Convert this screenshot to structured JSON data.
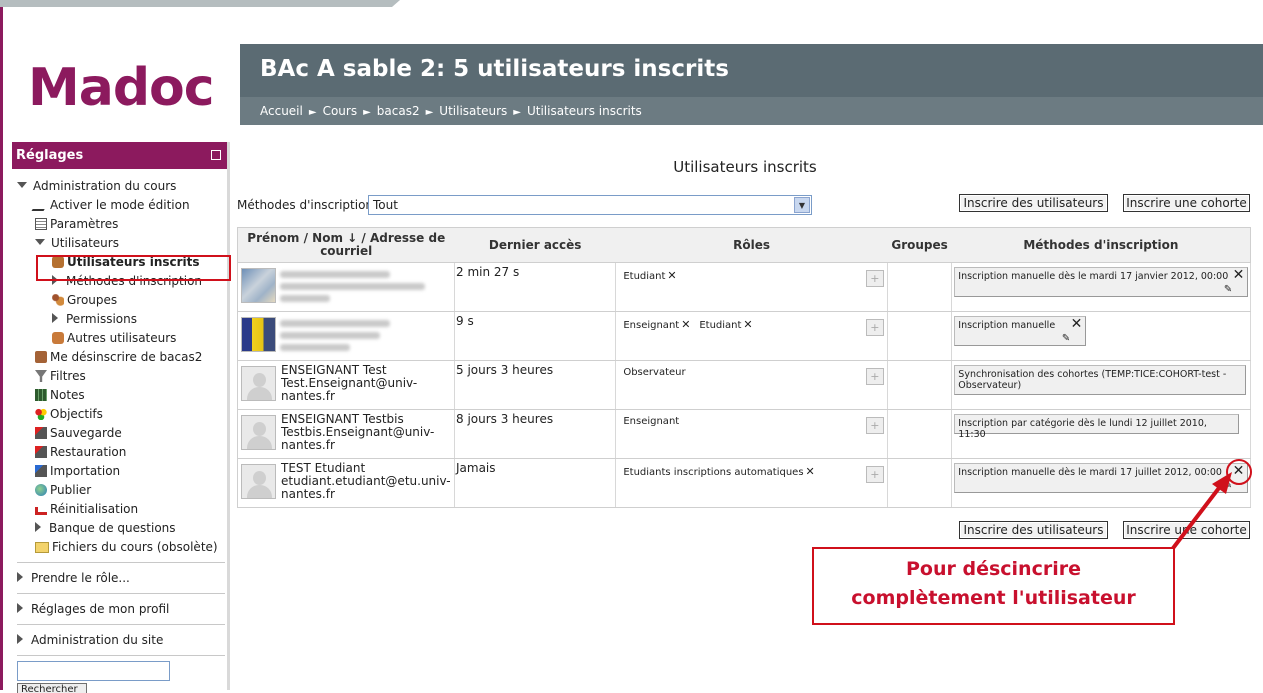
{
  "logo": "Madoc",
  "header": {
    "title": "BAc A sable 2: 5 utilisateurs inscrits",
    "breadcrumb": [
      "Accueil",
      "Cours",
      "bacas2",
      "Utilisateurs",
      "Utilisateurs inscrits"
    ]
  },
  "sidebar": {
    "block_title": "Réglages",
    "admin_cours": "Administration du cours",
    "items": {
      "edit_mode": "Activer le mode édition",
      "params": "Paramètres",
      "users": "Utilisateurs",
      "enrolled": "Utilisateurs inscrits",
      "methods": "Méthodes d'inscription",
      "groups": "Groupes",
      "permissions": "Permissions",
      "other_users": "Autres utilisateurs",
      "unenrol_me": "Me désinscrire de bacas2",
      "filters": "Filtres",
      "grades": "Notes",
      "outcomes": "Objectifs",
      "backup": "Sauvegarde",
      "restore": "Restauration",
      "import": "Importation",
      "publish": "Publier",
      "reset": "Réinitialisation",
      "question_bank": "Banque de questions",
      "legacy_files": "Fichiers du cours (obsolète)"
    },
    "switch_role": "Prendre le rôle...",
    "profile_settings": "Réglages de mon profil",
    "site_admin": "Administration du site",
    "search_button": "Rechercher"
  },
  "main": {
    "heading": "Utilisateurs inscrits",
    "methods_label": "Méthodes d'inscription",
    "methods_selected": "Tout",
    "enrol_users_btn": "Inscrire des utilisateurs",
    "enrol_cohort_btn": "Inscrire une cohorte",
    "columns": {
      "name_col_1": "Prénom / Nom",
      "name_col_2": "/ Adresse de courriel",
      "last_access": "Dernier accès",
      "roles": "Rôles",
      "groups": "Groupes",
      "methods": "Méthodes d'inscription"
    },
    "rows": [
      {
        "name": "",
        "email": "",
        "last_access": "2 min 27 s",
        "roles": [
          "Etudiant"
        ],
        "method": "Inscription manuelle dès le mardi 17 janvier 2012, 00:00"
      },
      {
        "name": "",
        "email": "",
        "last_access": "9 s",
        "roles": [
          "Enseignant",
          "Etudiant"
        ],
        "method": "Inscription manuelle"
      },
      {
        "name": "ENSEIGNANT Test",
        "email": "Test.Enseignant@univ-nantes.fr",
        "last_access": "5 jours 3 heures",
        "roles": [
          "Observateur"
        ],
        "method": "Synchronisation des cohortes (TEMP:TICE:COHORT-test - Observateur)"
      },
      {
        "name": "ENSEIGNANT Testbis",
        "email": "Testbis.Enseignant@univ-nantes.fr",
        "last_access": "8 jours 3 heures",
        "roles": [
          "Enseignant"
        ],
        "method": "Inscription par catégorie dès le lundi 12 juillet 2010, 11:30"
      },
      {
        "name": "TEST Etudiant",
        "email": "etudiant.etudiant@etu.univ-nantes.fr",
        "last_access": "Jamais",
        "roles": [
          "Etudiants inscriptions automatiques"
        ],
        "method": "Inscription manuelle dès le mardi 17 juillet 2012, 00:00"
      }
    ]
  },
  "callout": {
    "line1": "Pour déscincrire",
    "line2": "complètement l'utilisateur"
  }
}
